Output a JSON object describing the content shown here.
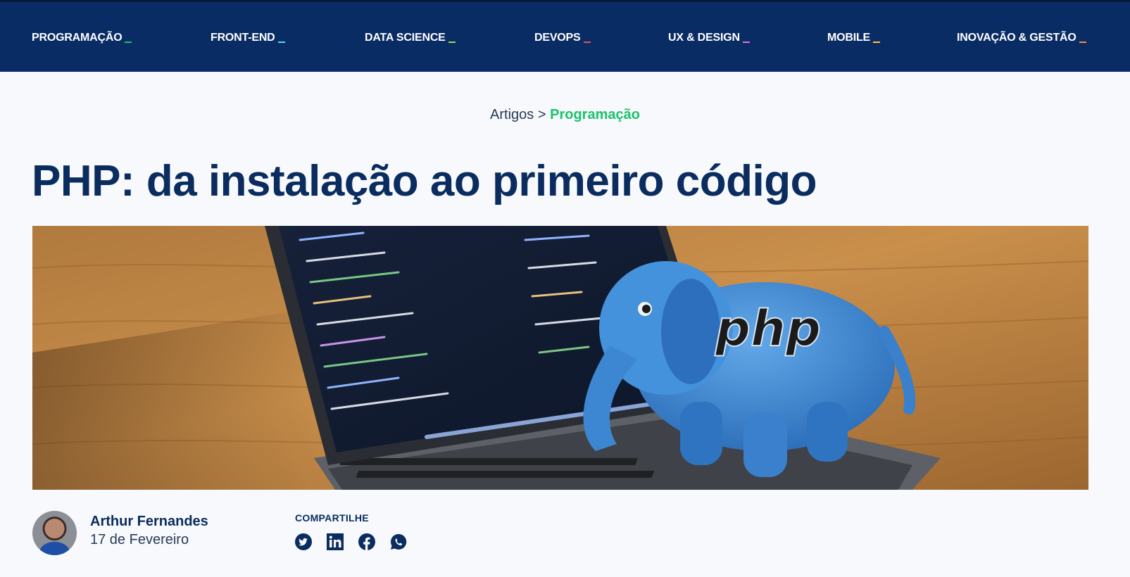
{
  "nav": {
    "items": [
      {
        "label": "PROGRAMAÇÃO",
        "accent": "#1bc36b"
      },
      {
        "label": "FRONT-END",
        "accent": "#5fd3f3"
      },
      {
        "label": "DATA SCIENCE",
        "accent": "#9ad94b"
      },
      {
        "label": "DEVOPS",
        "accent": "#f14a6b"
      },
      {
        "label": "UX & DESIGN",
        "accent": "#e46de6"
      },
      {
        "label": "MOBILE",
        "accent": "#ffc82c"
      },
      {
        "label": "INOVAÇÃO & GESTÃO",
        "accent": "#ff8a3d"
      }
    ]
  },
  "breadcrumb": {
    "parent": "Artigos",
    "separator": ">",
    "current": "Programação"
  },
  "article": {
    "title": "PHP: da instalação ao primeiro código",
    "hero_alt": "laptop with code and blue plush php elephant",
    "hero_text": "php"
  },
  "author": {
    "name": "Arthur Fernandes",
    "date": "17 de Fevereiro"
  },
  "share": {
    "label": "COMPARTILHE",
    "icons": [
      "twitter-icon",
      "linkedin-icon",
      "facebook-icon",
      "whatsapp-icon"
    ]
  },
  "colors": {
    "nav_bg": "#0a2c64",
    "title": "#0a2c5e",
    "accent_green": "#1bc36b",
    "page_bg": "#f7f9fc"
  }
}
